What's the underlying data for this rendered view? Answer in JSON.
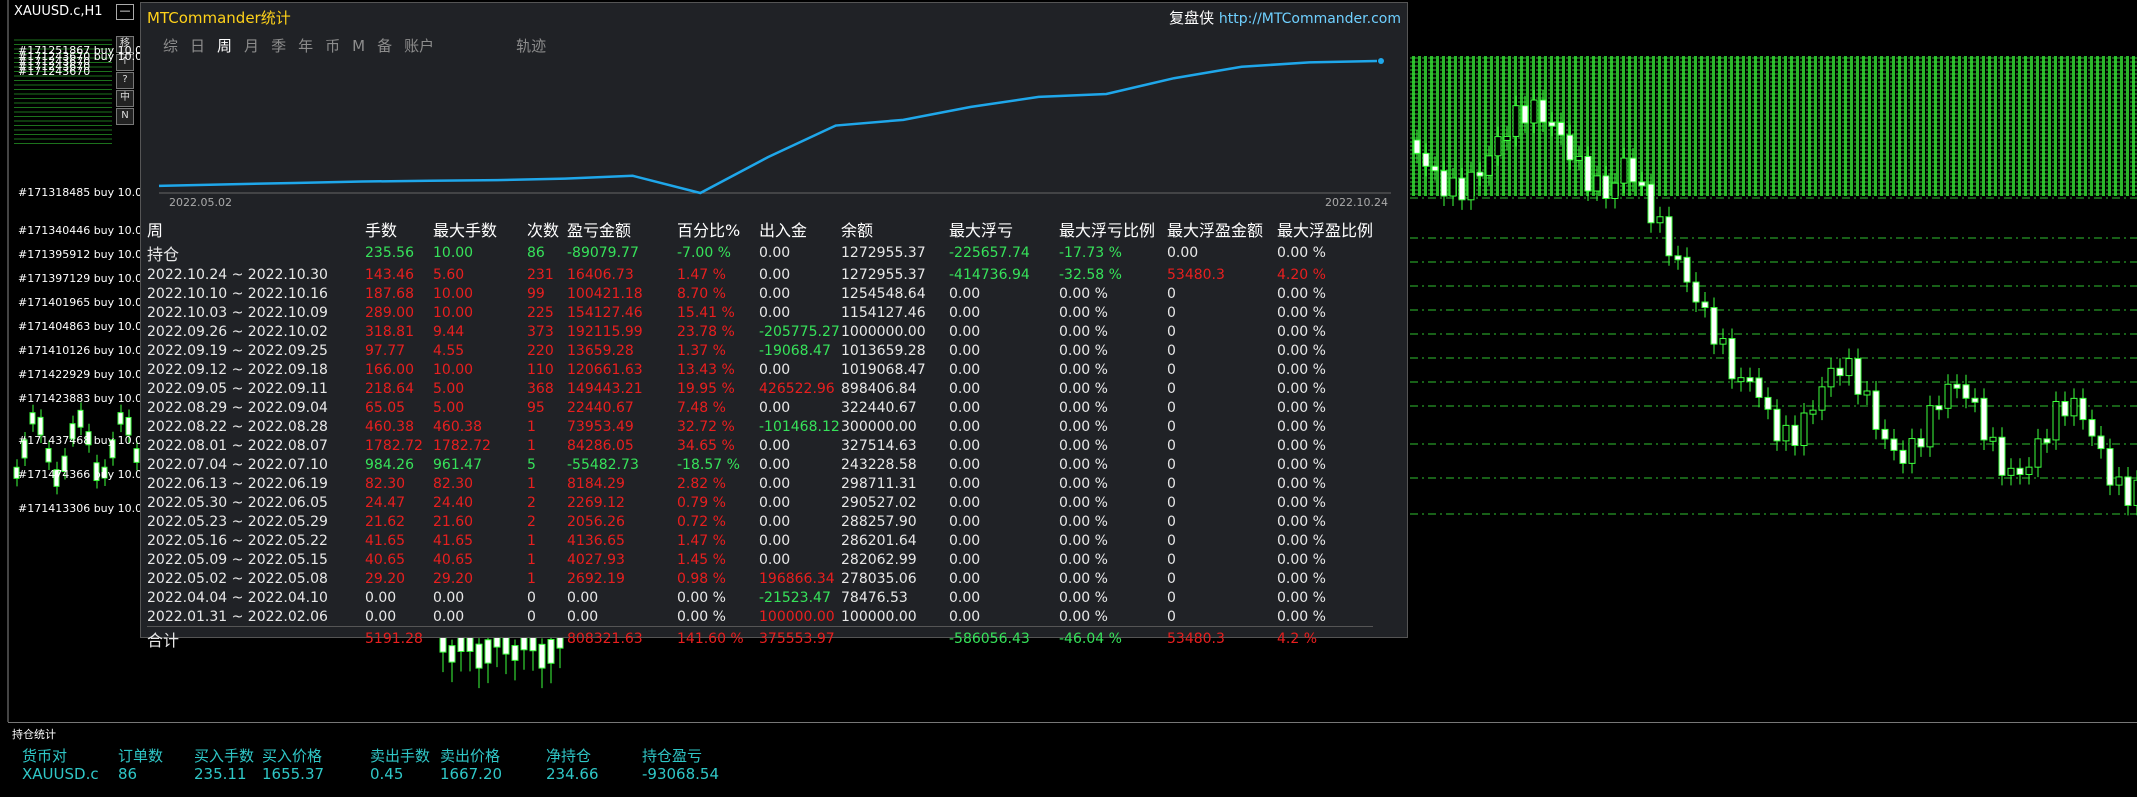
{
  "window": {
    "symbol_title": "XAUUSD.c,H1",
    "min_button": "—"
  },
  "side_buttons": [
    "移",
    "↑",
    "?",
    "中",
    "N"
  ],
  "order_labels": [
    "#171251867 buy 10.0",
    "#171243670 buy 10.0",
    "#171243670",
    "#171243670",
    "#171243670",
    "#171318485 buy 10.0",
    "#171340446 buy 10.0",
    "#171395912 buy 10.0",
    "#171397129 buy 10.0",
    "#171401965 buy 10.0",
    "#171404863 buy 10.0",
    "#171410126 buy 10.0",
    "#171422929 buy 10.0",
    "#171423883 buy 10.0",
    "#171437468 buy 10.0",
    "#171474366 buy 10.0",
    "#171413306 buy 10.0"
  ],
  "panel": {
    "title": "MTCommander统计",
    "brand_cn": "复盘侠",
    "brand_url": "http://MTCommander.com",
    "tabs": [
      "综",
      "日",
      "周",
      "月",
      "季",
      "年",
      "币",
      "M",
      "备",
      "账户"
    ],
    "active_tab": "周",
    "track_tab": "轨迹",
    "date_start": "2022.05.02",
    "date_end": "2022.10.24",
    "equity_curve": [
      0.0,
      0.01,
      0.02,
      0.03,
      0.035,
      0.04,
      0.05,
      0.07,
      -0.05,
      0.2,
      0.42,
      0.46,
      0.55,
      0.62,
      0.64,
      0.75,
      0.83,
      0.86,
      0.87
    ],
    "columns": [
      "周",
      "手数",
      "最大手数",
      "次数",
      "盈亏金额",
      "百分比%",
      "出入金",
      "余额",
      "最大浮亏",
      "最大浮亏比例",
      "最大浮盈金额",
      "最大浮盈比例"
    ],
    "rows": [
      {
        "c": [
          "持仓",
          "235.56",
          "10.00",
          "86",
          "-89079.77",
          "-7.00 %",
          "0.00",
          "1272955.37",
          "-225657.74",
          "-17.73 %",
          "0.00",
          "0.00 %"
        ],
        "k": [
          "w",
          "g",
          "g",
          "g",
          "g",
          "g",
          "w",
          "w",
          "g",
          "g",
          "w",
          "w"
        ]
      },
      {
        "c": [
          "2022.10.24 ~ 2022.10.30",
          "143.46",
          "5.60",
          "231",
          "16406.73",
          "1.47 %",
          "0.00",
          "1272955.37",
          "-414736.94",
          "-32.58 %",
          "53480.3",
          "4.20 %"
        ],
        "k": [
          "w",
          "r",
          "r",
          "r",
          "r",
          "r",
          "w",
          "w",
          "g",
          "g",
          "r",
          "r"
        ]
      },
      {
        "c": [
          "2022.10.10 ~ 2022.10.16",
          "187.68",
          "10.00",
          "99",
          "100421.18",
          "8.70 %",
          "0.00",
          "1254548.64",
          "0.00",
          "0.00 %",
          "0",
          "0.00 %"
        ],
        "k": [
          "w",
          "r",
          "r",
          "r",
          "r",
          "r",
          "w",
          "w",
          "w",
          "w",
          "w",
          "w"
        ]
      },
      {
        "c": [
          "2022.10.03 ~ 2022.10.09",
          "289.00",
          "10.00",
          "225",
          "154127.46",
          "15.41 %",
          "0.00",
          "1154127.46",
          "0.00",
          "0.00 %",
          "0",
          "0.00 %"
        ],
        "k": [
          "w",
          "r",
          "r",
          "r",
          "r",
          "r",
          "w",
          "w",
          "w",
          "w",
          "w",
          "w"
        ]
      },
      {
        "c": [
          "2022.09.26 ~ 2022.10.02",
          "318.81",
          "9.44",
          "373",
          "192115.99",
          "23.78 %",
          "-205775.27",
          "1000000.00",
          "0.00",
          "0.00 %",
          "0",
          "0.00 %"
        ],
        "k": [
          "w",
          "r",
          "r",
          "r",
          "r",
          "r",
          "g",
          "w",
          "w",
          "w",
          "w",
          "w"
        ]
      },
      {
        "c": [
          "2022.09.19 ~ 2022.09.25",
          "97.77",
          "4.55",
          "220",
          "13659.28",
          "1.37 %",
          "-19068.47",
          "1013659.28",
          "0.00",
          "0.00 %",
          "0",
          "0.00 %"
        ],
        "k": [
          "w",
          "r",
          "r",
          "r",
          "r",
          "r",
          "g",
          "w",
          "w",
          "w",
          "w",
          "w"
        ]
      },
      {
        "c": [
          "2022.09.12 ~ 2022.09.18",
          "166.00",
          "10.00",
          "110",
          "120661.63",
          "13.43 %",
          "0.00",
          "1019068.47",
          "0.00",
          "0.00 %",
          "0",
          "0.00 %"
        ],
        "k": [
          "w",
          "r",
          "r",
          "r",
          "r",
          "r",
          "w",
          "w",
          "w",
          "w",
          "w",
          "w"
        ]
      },
      {
        "c": [
          "2022.09.05 ~ 2022.09.11",
          "218.64",
          "5.00",
          "368",
          "149443.21",
          "19.95 %",
          "426522.96",
          "898406.84",
          "0.00",
          "0.00 %",
          "0",
          "0.00 %"
        ],
        "k": [
          "w",
          "r",
          "r",
          "r",
          "r",
          "r",
          "r",
          "w",
          "w",
          "w",
          "w",
          "w"
        ]
      },
      {
        "c": [
          "2022.08.29 ~ 2022.09.04",
          "65.05",
          "5.00",
          "95",
          "22440.67",
          "7.48 %",
          "0.00",
          "322440.67",
          "0.00",
          "0.00 %",
          "0",
          "0.00 %"
        ],
        "k": [
          "w",
          "r",
          "r",
          "r",
          "r",
          "r",
          "w",
          "w",
          "w",
          "w",
          "w",
          "w"
        ]
      },
      {
        "c": [
          "2022.08.22 ~ 2022.08.28",
          "460.38",
          "460.38",
          "1",
          "73953.49",
          "32.72 %",
          "-101468.12",
          "300000.00",
          "0.00",
          "0.00 %",
          "0",
          "0.00 %"
        ],
        "k": [
          "w",
          "r",
          "r",
          "r",
          "r",
          "r",
          "g",
          "w",
          "w",
          "w",
          "w",
          "w"
        ]
      },
      {
        "c": [
          "2022.08.01 ~ 2022.08.07",
          "1782.72",
          "1782.72",
          "1",
          "84286.05",
          "34.65 %",
          "0.00",
          "327514.63",
          "0.00",
          "0.00 %",
          "0",
          "0.00 %"
        ],
        "k": [
          "w",
          "r",
          "r",
          "r",
          "r",
          "r",
          "w",
          "w",
          "w",
          "w",
          "w",
          "w"
        ]
      },
      {
        "c": [
          "2022.07.04 ~ 2022.07.10",
          "984.26",
          "961.47",
          "5",
          "-55482.73",
          "-18.57 %",
          "0.00",
          "243228.58",
          "0.00",
          "0.00 %",
          "0",
          "0.00 %"
        ],
        "k": [
          "w",
          "g",
          "g",
          "g",
          "g",
          "g",
          "w",
          "w",
          "w",
          "w",
          "w",
          "w"
        ]
      },
      {
        "c": [
          "2022.06.13 ~ 2022.06.19",
          "82.30",
          "82.30",
          "1",
          "8184.29",
          "2.82 %",
          "0.00",
          "298711.31",
          "0.00",
          "0.00 %",
          "0",
          "0.00 %"
        ],
        "k": [
          "w",
          "r",
          "r",
          "r",
          "r",
          "r",
          "w",
          "w",
          "w",
          "w",
          "w",
          "w"
        ]
      },
      {
        "c": [
          "2022.05.30 ~ 2022.06.05",
          "24.47",
          "24.40",
          "2",
          "2269.12",
          "0.79 %",
          "0.00",
          "290527.02",
          "0.00",
          "0.00 %",
          "0",
          "0.00 %"
        ],
        "k": [
          "w",
          "r",
          "r",
          "r",
          "r",
          "r",
          "w",
          "w",
          "w",
          "w",
          "w",
          "w"
        ]
      },
      {
        "c": [
          "2022.05.23 ~ 2022.05.29",
          "21.62",
          "21.60",
          "2",
          "2056.26",
          "0.72 %",
          "0.00",
          "288257.90",
          "0.00",
          "0.00 %",
          "0",
          "0.00 %"
        ],
        "k": [
          "w",
          "r",
          "r",
          "r",
          "r",
          "r",
          "w",
          "w",
          "w",
          "w",
          "w",
          "w"
        ]
      },
      {
        "c": [
          "2022.05.16 ~ 2022.05.22",
          "41.65",
          "41.65",
          "1",
          "4136.65",
          "1.47 %",
          "0.00",
          "286201.64",
          "0.00",
          "0.00 %",
          "0",
          "0.00 %"
        ],
        "k": [
          "w",
          "r",
          "r",
          "r",
          "r",
          "r",
          "w",
          "w",
          "w",
          "w",
          "w",
          "w"
        ]
      },
      {
        "c": [
          "2022.05.09 ~ 2022.05.15",
          "40.65",
          "40.65",
          "1",
          "4027.93",
          "1.45 %",
          "0.00",
          "282062.99",
          "0.00",
          "0.00 %",
          "0",
          "0.00 %"
        ],
        "k": [
          "w",
          "r",
          "r",
          "r",
          "r",
          "r",
          "w",
          "w",
          "w",
          "w",
          "w",
          "w"
        ]
      },
      {
        "c": [
          "2022.05.02 ~ 2022.05.08",
          "29.20",
          "29.20",
          "1",
          "2692.19",
          "0.98 %",
          "196866.34",
          "278035.06",
          "0.00",
          "0.00 %",
          "0",
          "0.00 %"
        ],
        "k": [
          "w",
          "r",
          "r",
          "r",
          "r",
          "r",
          "r",
          "w",
          "w",
          "w",
          "w",
          "w"
        ]
      },
      {
        "c": [
          "2022.04.04 ~ 2022.04.10",
          "0.00",
          "0.00",
          "0",
          "0.00",
          "0.00 %",
          "-21523.47",
          "78476.53",
          "0.00",
          "0.00 %",
          "0",
          "0.00 %"
        ],
        "k": [
          "w",
          "w",
          "w",
          "w",
          "w",
          "w",
          "g",
          "w",
          "w",
          "w",
          "w",
          "w"
        ]
      },
      {
        "c": [
          "2022.01.31 ~ 2022.02.06",
          "0.00",
          "0.00",
          "0",
          "0.00",
          "0.00 %",
          "100000.00",
          "100000.00",
          "0.00",
          "0.00 %",
          "0",
          "0.00 %"
        ],
        "k": [
          "w",
          "w",
          "w",
          "w",
          "w",
          "w",
          "r",
          "w",
          "w",
          "w",
          "w",
          "w"
        ]
      }
    ],
    "total": {
      "c": [
        "合计",
        "5191.28",
        "",
        "",
        "808321.63",
        "141.60 %",
        "375553.97",
        "",
        "-586056.43",
        "-46.04 %",
        "53480.3",
        "4.2 %"
      ],
      "k": [
        "w",
        "r",
        "w",
        "w",
        "r",
        "r",
        "r",
        "w",
        "g",
        "g",
        "r",
        "r"
      ]
    }
  },
  "bottom": {
    "title": "持仓统计",
    "headers": [
      "货币对",
      "订单数",
      "买入手数",
      "买入价格",
      "卖出手数",
      "卖出价格",
      "净持仓",
      "持仓盈亏"
    ],
    "values": [
      "XAUUSD.c",
      "86",
      "235.11",
      "1655.37",
      "0.45",
      "1667.20",
      "234.66",
      "-93068.54"
    ]
  },
  "colors": {
    "profit": "#e81f1f",
    "loss": "#36e25a",
    "curve": "#1fa7ea",
    "title": "#ffd21a"
  }
}
